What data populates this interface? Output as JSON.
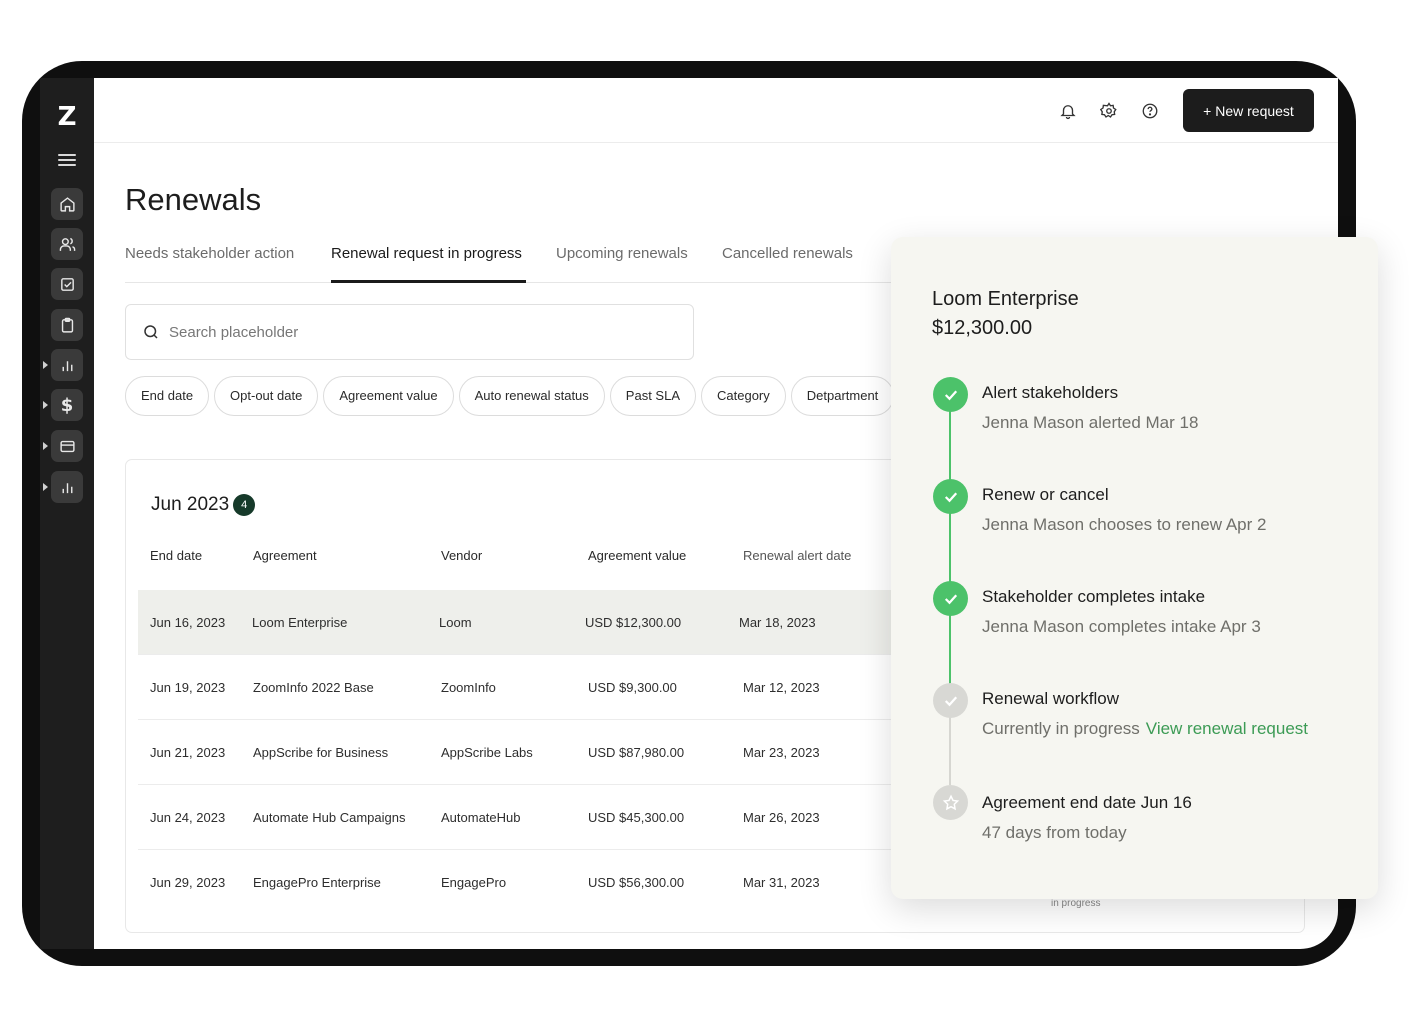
{
  "sidebar": {
    "logo": "Z",
    "items": [
      {
        "icon": "home-icon"
      },
      {
        "icon": "users-icon"
      },
      {
        "icon": "checkbox-icon"
      },
      {
        "icon": "clipboard-icon"
      },
      {
        "icon": "bar-chart-icon"
      },
      {
        "icon": "dollar-icon",
        "glyph": "$"
      },
      {
        "icon": "card-icon"
      },
      {
        "icon": "bar-chart-icon"
      }
    ]
  },
  "header": {
    "icons": [
      "bell-icon",
      "gear-icon",
      "help-icon"
    ],
    "new_request_label": "+ New request"
  },
  "page": {
    "title": "Renewals",
    "tabs": [
      {
        "label": "Needs stakeholder action"
      },
      {
        "label": "Renewal request in progress",
        "active": true
      },
      {
        "label": "Upcoming renewals"
      },
      {
        "label": "Cancelled renewals"
      }
    ],
    "search": {
      "placeholder": "Search placeholder"
    },
    "filters": [
      "End date",
      "Opt-out date",
      "Agreement value",
      "Auto renewal status",
      "Past SLA",
      "Category",
      "Detpartment"
    ]
  },
  "table": {
    "month": "Jun 2023",
    "count": "4",
    "columns": [
      "End date",
      "Agreement",
      "Vendor",
      "Agreement value",
      "Renewal alert date"
    ],
    "rows": [
      {
        "end_date": "Jun 16, 2023",
        "agreement": "Loom Enterprise",
        "vendor": "Loom",
        "value": "USD $12,300.00",
        "alert_date": "Mar 18, 2023"
      },
      {
        "end_date": "Jun 19, 2023",
        "agreement": "ZoomInfo 2022 Base",
        "vendor": "ZoomInfo",
        "value": "USD $9,300.00",
        "alert_date": "Mar 12, 2023"
      },
      {
        "end_date": "Jun 21, 2023",
        "agreement": "AppScribe for Business",
        "vendor": "AppScribe Labs",
        "value": "USD $87,980.00",
        "alert_date": "Mar 23, 2023"
      },
      {
        "end_date": "Jun 24, 2023",
        "agreement": "Automate Hub Campaigns",
        "vendor": "AutomateHub",
        "value": "USD $45,300.00",
        "alert_date": "Mar 26, 2023"
      },
      {
        "end_date": "Jun 29, 2023",
        "agreement": "EngagePro Enterprise",
        "vendor": "EngagePro",
        "value": "USD $56,300.00",
        "alert_date": "Mar 31, 2023"
      }
    ],
    "bottom_fragment": "in progress"
  },
  "panel": {
    "name": "Loom Enterprise",
    "amount": "$12,300.00",
    "steps": [
      {
        "title": "Alert stakeholders",
        "subtitle": "Jenna Mason alerted Mar 18",
        "status": "done"
      },
      {
        "title": "Renew or cancel",
        "subtitle": "Jenna Mason chooses to renew Apr 2",
        "status": "done"
      },
      {
        "title": "Stakeholder completes intake",
        "subtitle": "Jenna Mason completes intake Apr 3",
        "status": "done"
      },
      {
        "title": "Renewal workflow",
        "subtitle": "Currently in progress",
        "link": "View renewal request",
        "status": "in-progress"
      },
      {
        "title": "Agreement end date Jun 16",
        "subtitle": "47 days from today",
        "status": "upcoming"
      }
    ]
  },
  "colors": {
    "accent_green": "#4cc26a",
    "link_green": "#3c9b55",
    "dark": "#1c1c1c",
    "badge_bg": "#163a2a"
  }
}
